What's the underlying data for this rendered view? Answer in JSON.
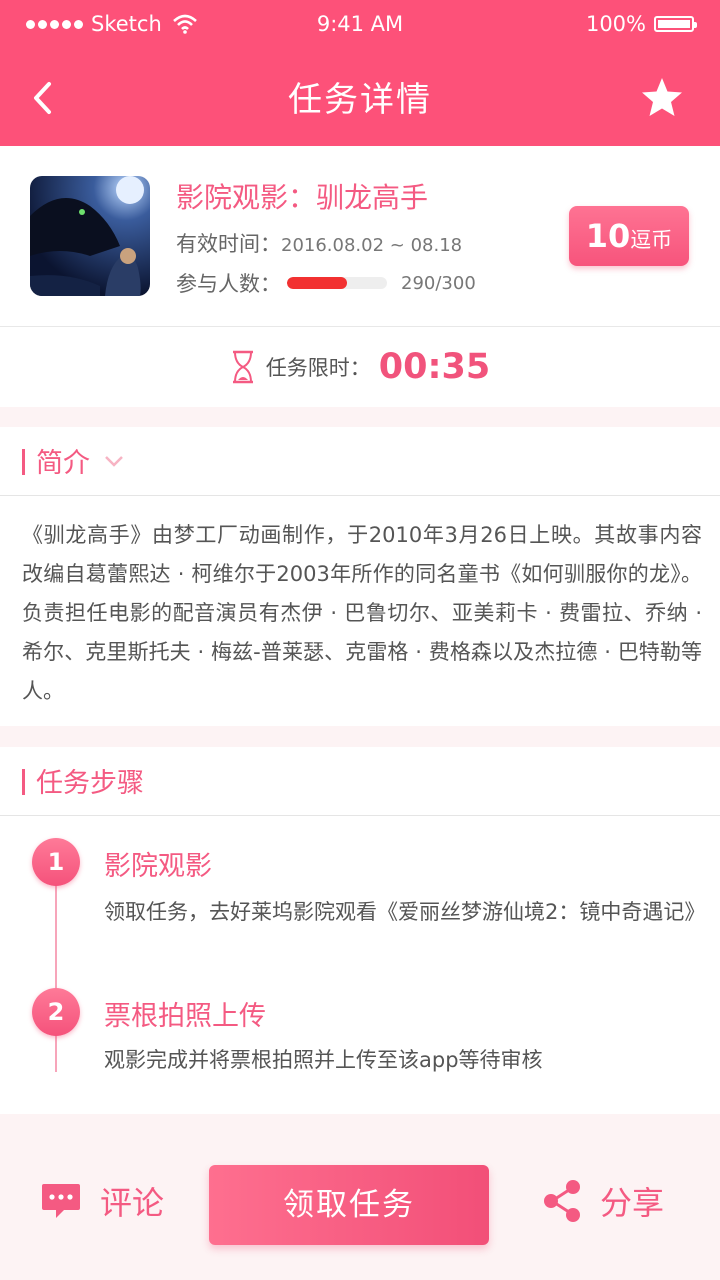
{
  "status": {
    "carrier": "Sketch",
    "time": "9:41 AM",
    "battery": "100%"
  },
  "nav": {
    "title": "任务详情",
    "back_icon": "chevron-left-icon",
    "favorite_icon": "star-icon"
  },
  "task": {
    "title": "影院观影：驯龙高手",
    "valid_label": "有效时间：",
    "valid_value": "2016.08.02 ~ 08.18",
    "participants_label": "参与人数：",
    "participants_value": "290/300",
    "participants_current": 290,
    "participants_max": 300,
    "progress_fill": 0.6,
    "reward_amount": "10",
    "reward_unit": "逗币"
  },
  "timer": {
    "label": "任务限时：",
    "value": "00:35",
    "icon": "hourglass-icon"
  },
  "intro": {
    "heading": "简介",
    "text": "《驯龙高手》由梦工厂动画制作，于2010年3月26日上映。其故事内容改编自葛蕾熙达 · 柯维尔于2003年所作的同名童书《如何驯服你的龙》。负责担任电影的配音演员有杰伊 · 巴鲁切尔、亚美莉卡 · 费雷拉、乔纳 · 希尔、克里斯托夫 · 梅兹-普莱瑟、克雷格 · 费格森以及杰拉德 · 巴特勒等人。"
  },
  "steps": {
    "heading": "任务步骤",
    "items": [
      {
        "num": "1",
        "title": "影院观影",
        "desc": "领取任务，去好莱坞影院观看《爱丽丝梦游仙境2：镜中奇遇记》"
      },
      {
        "num": "2",
        "title": "票根拍照上传",
        "desc": "观影完成并将票根拍照并上传至该app等待审核"
      }
    ]
  },
  "bottom": {
    "comment": "评论",
    "cta": "领取任务",
    "share": "分享"
  },
  "colors": {
    "brand": "#fd5179",
    "accent_text": "#f45a82",
    "progress": "#f23131"
  }
}
